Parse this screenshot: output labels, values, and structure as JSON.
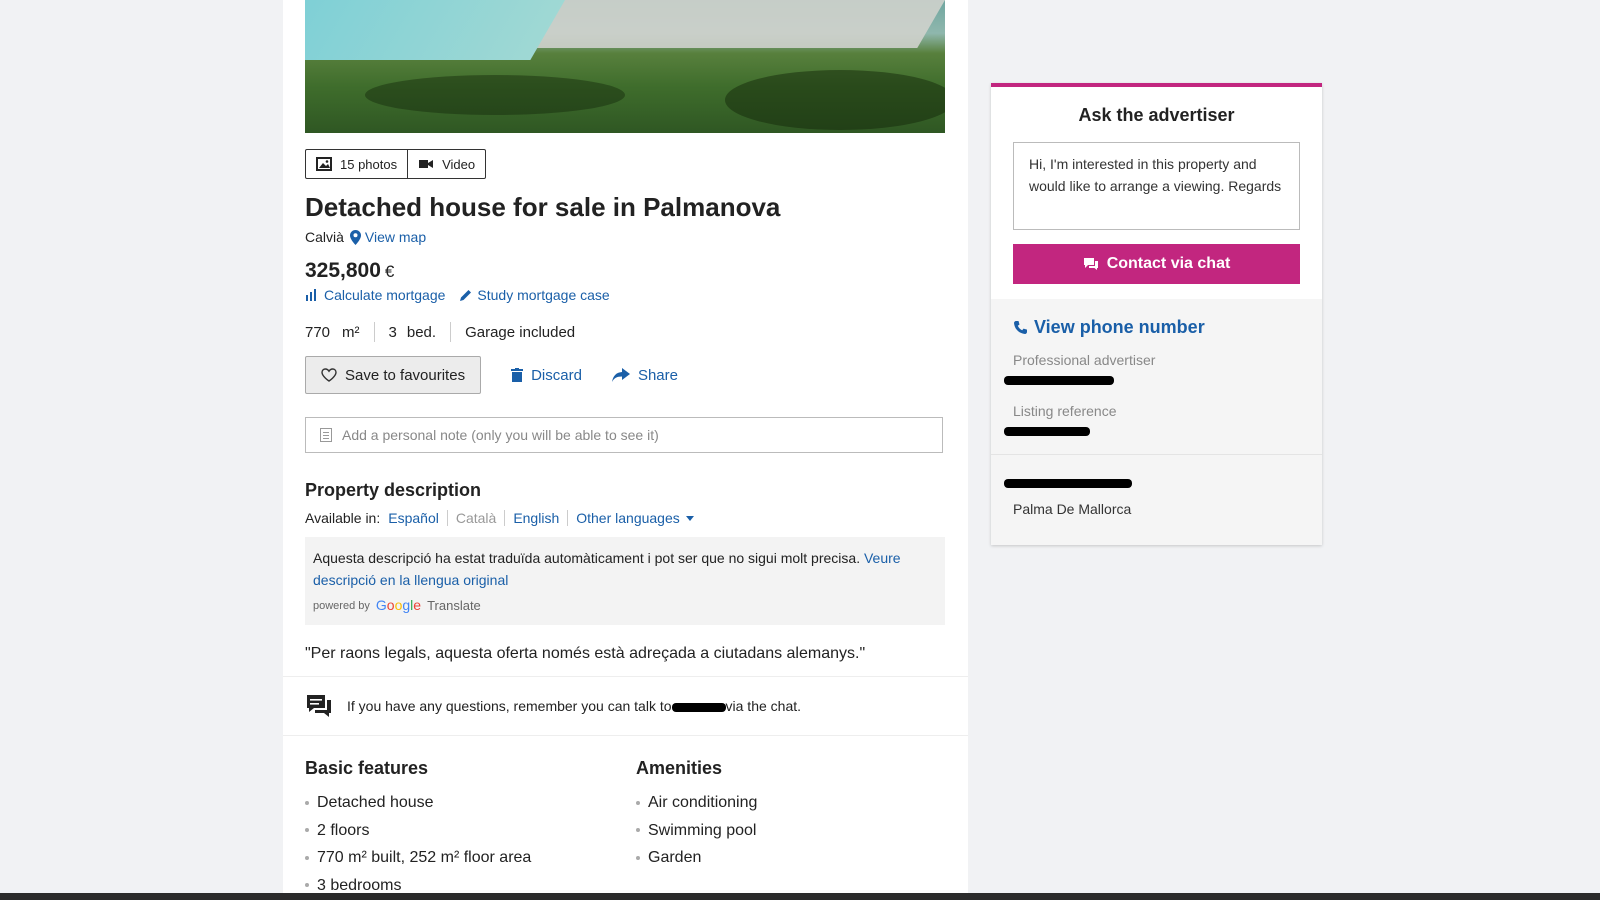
{
  "media": {
    "photos_label": "15 photos",
    "video_label": "Video"
  },
  "listing": {
    "title": "Detached house for sale in Palmanova",
    "location": "Calvià",
    "view_map": "View map",
    "price": "325,800",
    "currency": "€",
    "calc_mortgage": "Calculate mortgage",
    "study_mortgage": "Study mortgage case",
    "area_value": "770",
    "area_unit": "m²",
    "beds_value": "3",
    "beds_unit": "bed.",
    "garage": "Garage included"
  },
  "actions": {
    "save": "Save to favourites",
    "discard": "Discard",
    "share": "Share"
  },
  "note": {
    "placeholder": "Add a personal note (only you will be able to see it)"
  },
  "description": {
    "heading": "Property description",
    "available_in": "Available in:",
    "languages": [
      "Español",
      "Català",
      "English",
      "Other languages"
    ],
    "translated_notice": "Aquesta descripció ha estat traduïda automàticament i pot ser que no sigui molt precisa.",
    "original_link": "Veure descripció en la llengua original",
    "powered_by": "powered by",
    "google": "Google",
    "translate": "Translate",
    "quote": "\"Per raons legals, aquesta oferta només està adreçada a ciutadans alemanys.\""
  },
  "chat_hint": {
    "before": "If you have any questions, remember you can talk to",
    "after": "via the chat."
  },
  "basic_features": {
    "heading": "Basic features",
    "items": [
      "Detached house",
      "2 floors",
      "770 m² built, 252 m² floor area",
      "3 bedrooms"
    ]
  },
  "amenities": {
    "heading": "Amenities",
    "items": [
      "Air conditioning",
      "Swimming pool",
      "Garden"
    ]
  },
  "sidebar": {
    "heading": "Ask the advertiser",
    "message": "Hi, I'm interested in this property and would like to arrange a viewing. Regards",
    "contact_button": "Contact via chat",
    "phone_link": "View phone number",
    "advertiser_label": "Professional advertiser",
    "reference_label": "Listing reference",
    "city": "Palma De Mallorca"
  },
  "colors": {
    "accent": "#c2267f",
    "link": "#1a5fa8"
  }
}
